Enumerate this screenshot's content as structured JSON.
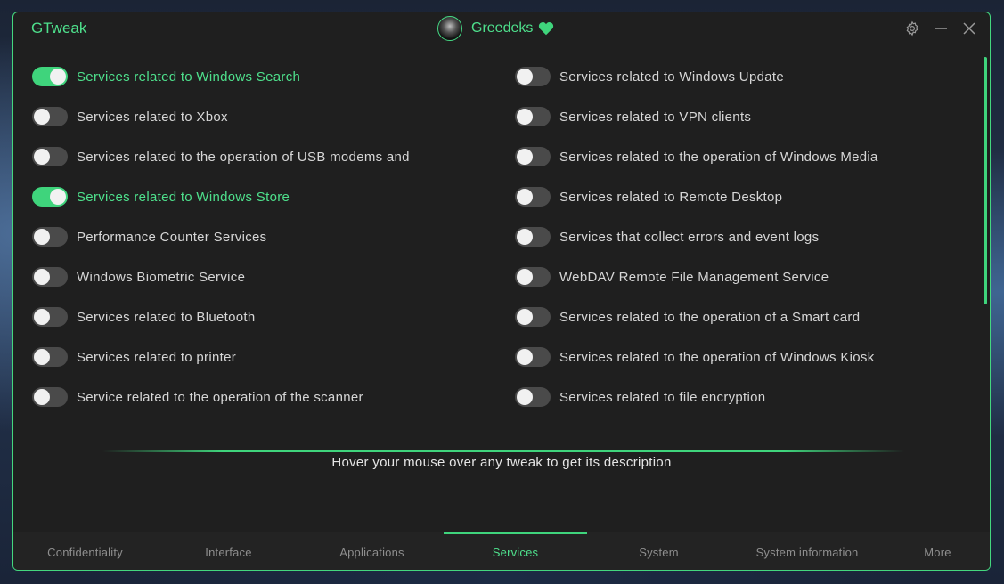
{
  "app": {
    "title": "GTweak",
    "accent_color": "#3fd47c"
  },
  "profile": {
    "name": "Greedeks",
    "avatar_icon": "avatar-icon",
    "badge_icon": "heart-icon"
  },
  "window_controls": [
    {
      "name": "settings-icon"
    },
    {
      "name": "minimize-icon"
    },
    {
      "name": "close-icon"
    }
  ],
  "toggles_left": [
    {
      "label": "Services related to Windows Search",
      "on": true
    },
    {
      "label": "Services related to Xbox",
      "on": false
    },
    {
      "label": "Services related to the operation of USB modems and",
      "on": false
    },
    {
      "label": "Services related to Windows Store",
      "on": true
    },
    {
      "label": "Performance Counter Services",
      "on": false
    },
    {
      "label": "Windows Biometric Service",
      "on": false
    },
    {
      "label": "Services related to Bluetooth",
      "on": false
    },
    {
      "label": "Services related to printer",
      "on": false
    },
    {
      "label": "Service related to the operation of the scanner",
      "on": false
    }
  ],
  "toggles_right": [
    {
      "label": "Services related to Windows Update",
      "on": false
    },
    {
      "label": "Services related to VPN clients",
      "on": false
    },
    {
      "label": "Services related to the operation of Windows Media",
      "on": false
    },
    {
      "label": "Services related to Remote Desktop",
      "on": false
    },
    {
      "label": "Services that collect errors and event logs",
      "on": false
    },
    {
      "label": "WebDAV Remote File Management Service",
      "on": false
    },
    {
      "label": "Services related to the operation of a Smart card",
      "on": false
    },
    {
      "label": "Services related to the operation of Windows Kiosk",
      "on": false
    },
    {
      "label": "Services related to file encryption",
      "on": false
    }
  ],
  "hint": "Hover your mouse over any tweak to get its description",
  "tabs": [
    {
      "label": "Confidentiality",
      "active": false
    },
    {
      "label": "Interface",
      "active": false
    },
    {
      "label": "Applications",
      "active": false
    },
    {
      "label": "Services",
      "active": true
    },
    {
      "label": "System",
      "active": false
    },
    {
      "label": "System information",
      "active": false
    },
    {
      "label": "More",
      "active": false
    }
  ]
}
